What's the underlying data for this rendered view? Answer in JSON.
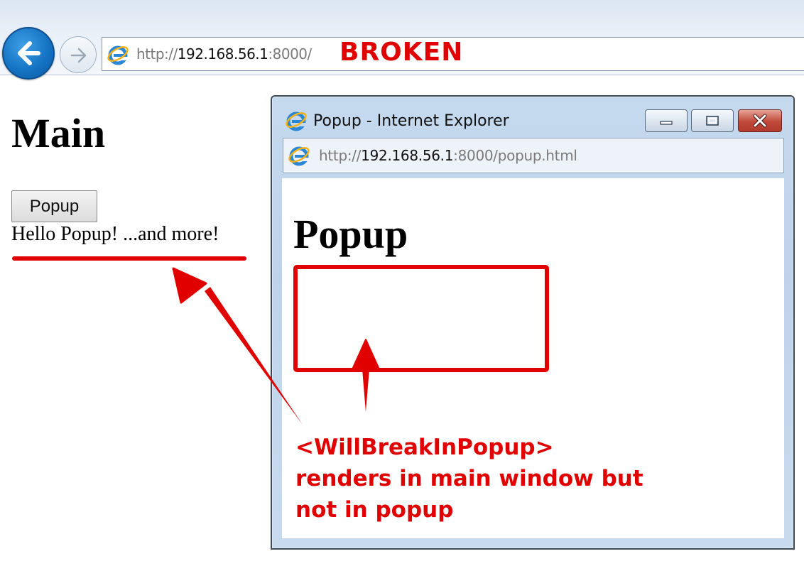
{
  "main_browser": {
    "url_scheme": "http://",
    "url_host": "192.168.56.1",
    "url_rest": ":8000/"
  },
  "annotation_label": "BROKEN",
  "main_page": {
    "heading": "Main",
    "popup_button_label": "Popup",
    "hello_text": "Hello Popup! ...and more!"
  },
  "popup_window": {
    "title": "Popup - Internet Explorer",
    "url_scheme": "http://",
    "url_host": "192.168.56.1",
    "url_rest": ":8000/popup.html",
    "heading": "Popup"
  },
  "annotation_text": "<WillBreakInPopup> renders in main window but not in popup",
  "colors": {
    "annotation_red": "#e00000",
    "ie_blue": "#1574c4",
    "close_red": "#c0483a"
  },
  "icons": {
    "back": "back-arrow-icon",
    "forward": "forward-arrow-icon",
    "browser": "internet-explorer-icon",
    "minimize": "minimize-icon",
    "maximize": "maximize-icon",
    "close": "close-icon"
  }
}
